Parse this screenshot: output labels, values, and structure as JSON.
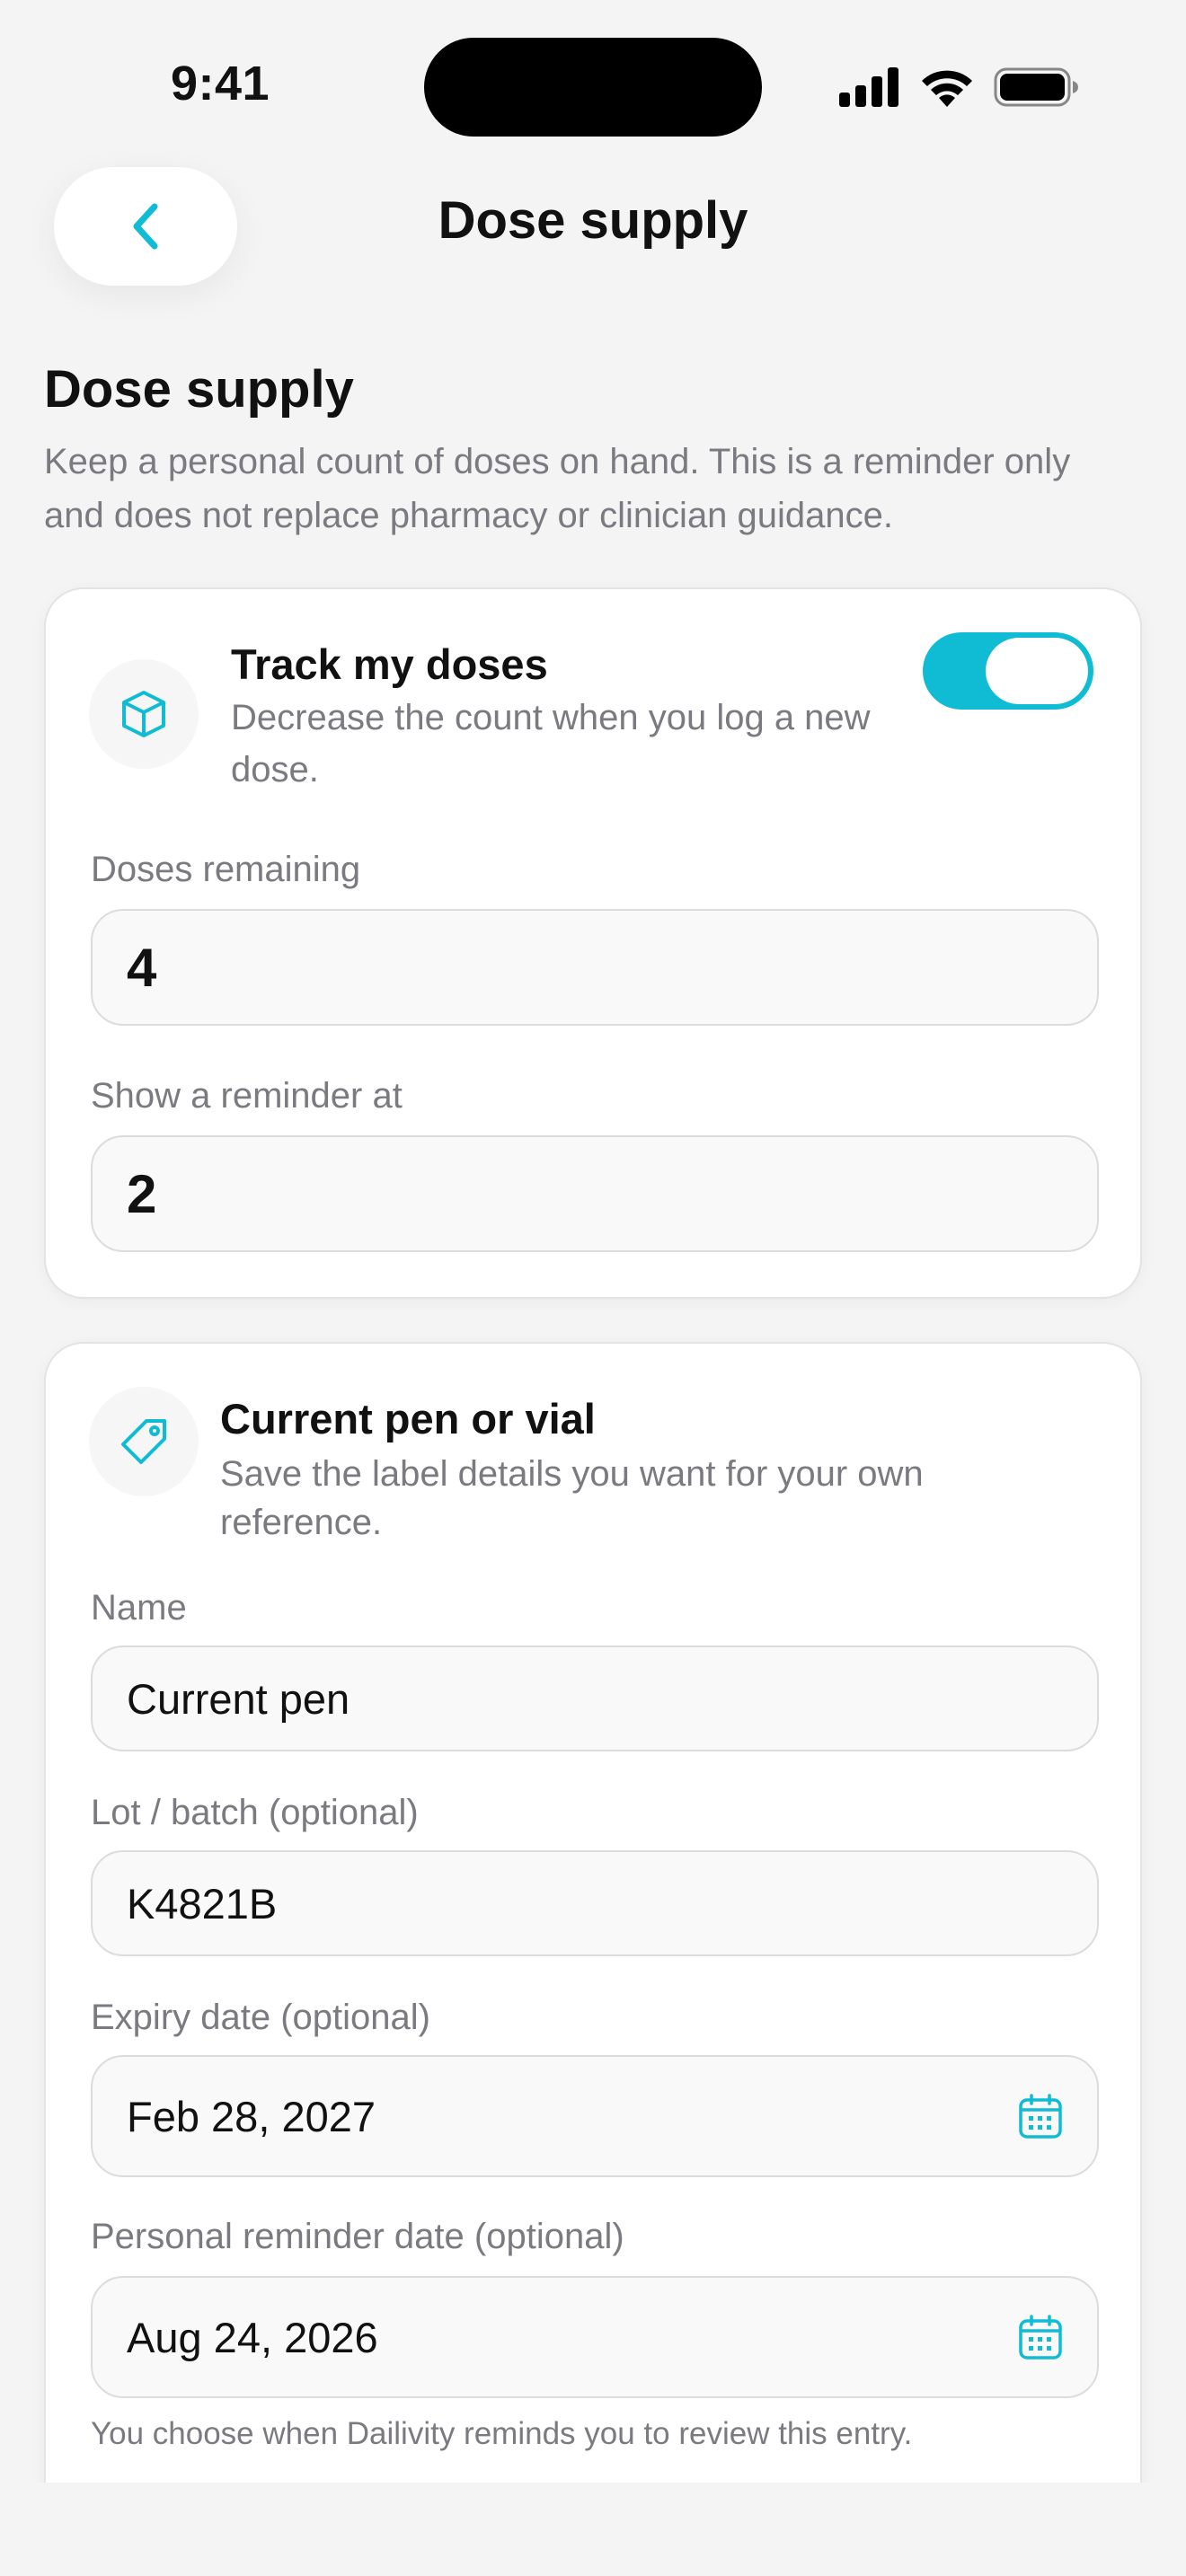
{
  "status_bar": {
    "time": "9:41"
  },
  "nav": {
    "title": "Dose supply",
    "back_icon": "chevron-left-icon"
  },
  "section": {
    "title": "Dose supply",
    "description": "Keep a personal count of doses on hand. This is a reminder only and does not replace pharmacy or clinician guidance."
  },
  "tracking_card": {
    "icon": "box-icon",
    "title": "Track my doses",
    "subtitle": "Decrease the count when you log a new dose.",
    "toggle_on": true,
    "doses_remaining_label": "Doses remaining",
    "doses_remaining_value": "4",
    "reminder_label": "Show a reminder at",
    "reminder_value": "2"
  },
  "pen_card": {
    "icon": "tag-icon",
    "title": "Current pen or vial",
    "subtitle": "Save the label details you want for your own reference.",
    "name_label": "Name",
    "name_value": "Current pen",
    "lot_label": "Lot / batch (optional)",
    "lot_value": "K4821B",
    "expiry_label": "Expiry date (optional)",
    "expiry_value": "Feb 28, 2027",
    "personal_reminder_label": "Personal reminder date (optional)",
    "personal_reminder_value": "Aug 24, 2026",
    "helper": "You choose when Dailivity reminds you to review this entry."
  },
  "colors": {
    "accent": "#0fbcd4",
    "background": "#f4f4f5",
    "card": "#ffffff",
    "muted_text": "#7a7a80"
  }
}
